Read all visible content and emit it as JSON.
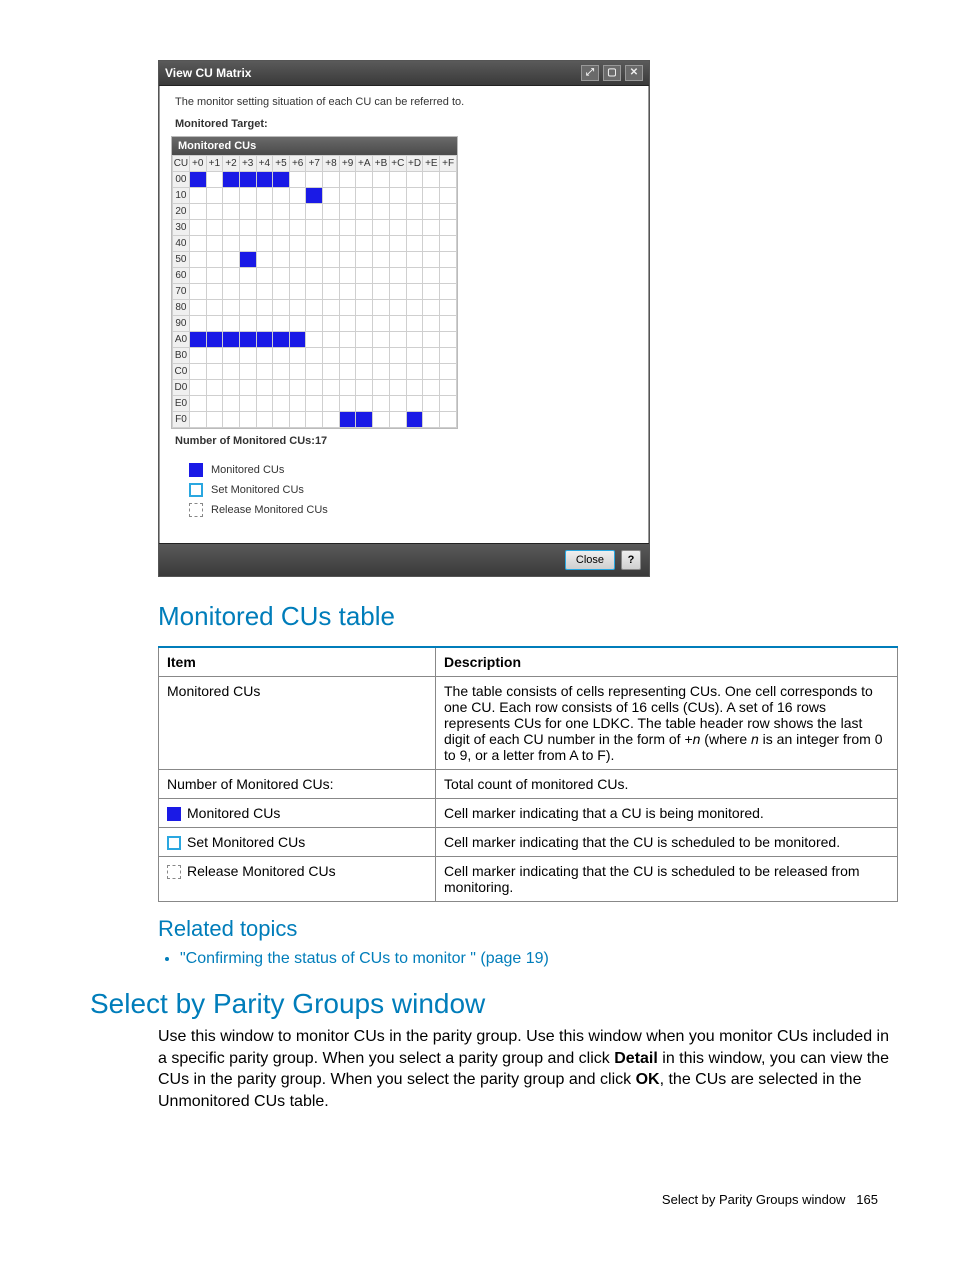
{
  "dialog": {
    "title": "View CU Matrix",
    "subtext": "The monitor setting situation of each CU can be referred to.",
    "target_label": "Monitored Target:",
    "matrix_header": "Monitored CUs",
    "cu_label": "CU",
    "cols": [
      "+0",
      "+1",
      "+2",
      "+3",
      "+4",
      "+5",
      "+6",
      "+7",
      "+8",
      "+9",
      "+A",
      "+B",
      "+C",
      "+D",
      "+E",
      "+F"
    ],
    "rows": [
      "00",
      "10",
      "20",
      "30",
      "40",
      "50",
      "60",
      "70",
      "80",
      "90",
      "A0",
      "B0",
      "C0",
      "D0",
      "E0",
      "F0"
    ],
    "count_label": "Number of Monitored CUs:17",
    "legend": {
      "monitored": "Monitored CUs",
      "set": "Set Monitored CUs",
      "release": "Release Monitored CUs"
    },
    "close": "Close",
    "help": "?"
  },
  "headings": {
    "monitored_table": "Monitored CUs table",
    "related": "Related topics",
    "select_parity": "Select by Parity Groups window"
  },
  "table": {
    "h_item": "Item",
    "h_desc": "Description",
    "r1_item": "Monitored CUs",
    "r1_desc_a": "The table consists of cells representing CUs. One cell corresponds to one CU. Each row consists of 16 cells (CUs). A set of 16 rows represents CUs for one LDKC. The table header row shows the last digit of each CU number in the form of +",
    "r1_desc_b": "n",
    "r1_desc_c": " (where ",
    "r1_desc_d": "n",
    "r1_desc_e": " is an integer from 0 to 9, or a letter from A to F).",
    "r2_item": "Number of Monitored CUs:",
    "r2_desc": "Total count of monitored CUs.",
    "r3_item": "Monitored CUs",
    "r3_desc": "Cell marker indicating that a CU is being monitored.",
    "r4_item": "Set Monitored CUs",
    "r4_desc": "Cell marker indicating that the CU is scheduled to be monitored.",
    "r5_item": "Release Monitored CUs",
    "r5_desc": "Cell marker indicating that the CU is scheduled to be released from monitoring."
  },
  "related_link": "\"Confirming the status of CUs to monitor \" (page 19)",
  "parity_para_a": "Use this window to monitor CUs in the parity group. Use this window when you monitor CUs included in a specific parity group. When you select a parity group and click ",
  "parity_para_b": "Detail",
  "parity_para_c": " in this window, you can view the CUs in the parity group. When you select the parity group and click ",
  "parity_para_d": "OK",
  "parity_para_e": ", the CUs are selected in the Unmonitored CUs table.",
  "footer": {
    "text": "Select by Parity Groups window",
    "page": "165"
  },
  "chart_data": {
    "type": "heatmap",
    "title": "Monitored CUs",
    "rows": [
      "00",
      "10",
      "20",
      "30",
      "40",
      "50",
      "60",
      "70",
      "80",
      "90",
      "A0",
      "B0",
      "C0",
      "D0",
      "E0",
      "F0"
    ],
    "cols": [
      "+0",
      "+1",
      "+2",
      "+3",
      "+4",
      "+5",
      "+6",
      "+7",
      "+8",
      "+9",
      "+A",
      "+B",
      "+C",
      "+D",
      "+E",
      "+F"
    ],
    "monitored_cells": [
      {
        "row": "00",
        "col": "+0"
      },
      {
        "row": "00",
        "col": "+2"
      },
      {
        "row": "00",
        "col": "+3"
      },
      {
        "row": "00",
        "col": "+4"
      },
      {
        "row": "00",
        "col": "+5"
      },
      {
        "row": "10",
        "col": "+7"
      },
      {
        "row": "50",
        "col": "+3"
      },
      {
        "row": "A0",
        "col": "+0"
      },
      {
        "row": "A0",
        "col": "+1"
      },
      {
        "row": "A0",
        "col": "+2"
      },
      {
        "row": "A0",
        "col": "+3"
      },
      {
        "row": "A0",
        "col": "+4"
      },
      {
        "row": "A0",
        "col": "+5"
      },
      {
        "row": "A0",
        "col": "+6"
      },
      {
        "row": "F0",
        "col": "+9"
      },
      {
        "row": "F0",
        "col": "+A"
      },
      {
        "row": "F0",
        "col": "+D"
      }
    ],
    "total_monitored": 17
  }
}
